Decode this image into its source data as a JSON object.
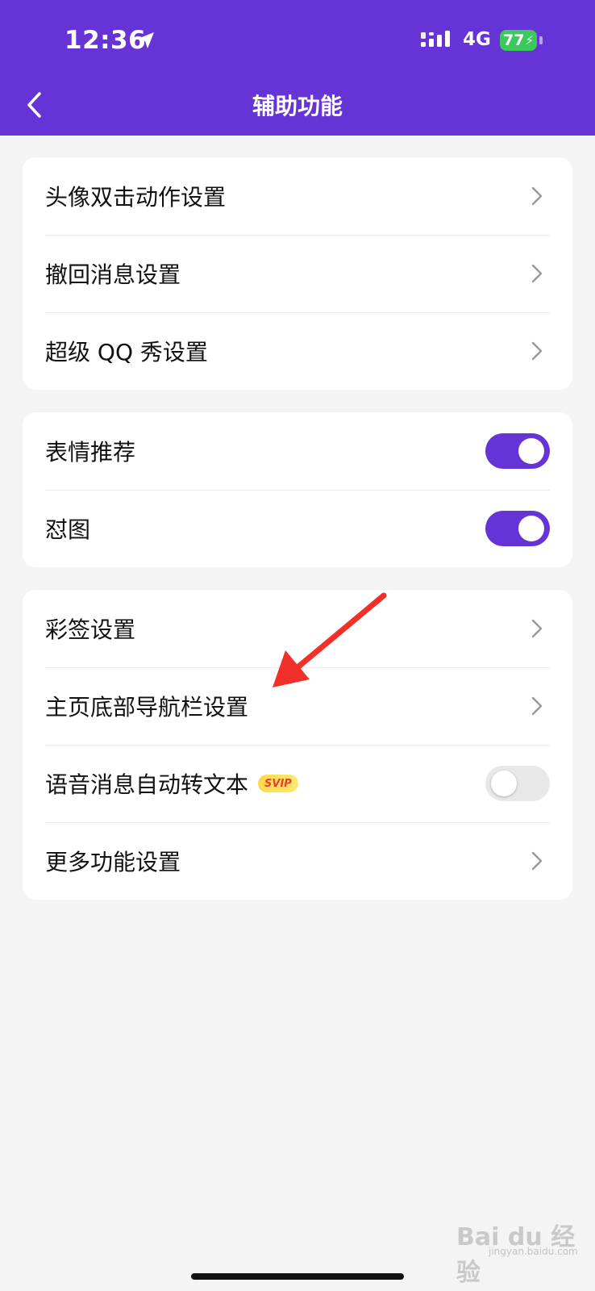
{
  "status_bar": {
    "time": "12:36",
    "network": "4G",
    "battery": "77"
  },
  "header": {
    "title": "辅助功能"
  },
  "groups": [
    {
      "items": [
        {
          "label": "头像双击动作设置",
          "control": "chevron"
        },
        {
          "label": "撤回消息设置",
          "control": "chevron"
        },
        {
          "label": "超级 QQ 秀设置",
          "control": "chevron"
        }
      ]
    },
    {
      "items": [
        {
          "label": "表情推荐",
          "control": "toggle",
          "on": true
        },
        {
          "label": "怼图",
          "control": "toggle",
          "on": true
        }
      ]
    },
    {
      "items": [
        {
          "label": "彩签设置",
          "control": "chevron"
        },
        {
          "label": "主页底部导航栏设置",
          "control": "chevron"
        },
        {
          "label": "语音消息自动转文本",
          "badge": "SVIP",
          "control": "toggle",
          "on": false
        },
        {
          "label": "更多功能设置",
          "control": "chevron"
        }
      ]
    }
  ],
  "colors": {
    "accent": "#6633d6",
    "toggle_off": "#e8e8e8",
    "battery": "#3cc85c",
    "annotation": "#f2302a"
  },
  "watermark": {
    "text": "Bai du 经验",
    "sub": "jingyan.baidu.com"
  }
}
